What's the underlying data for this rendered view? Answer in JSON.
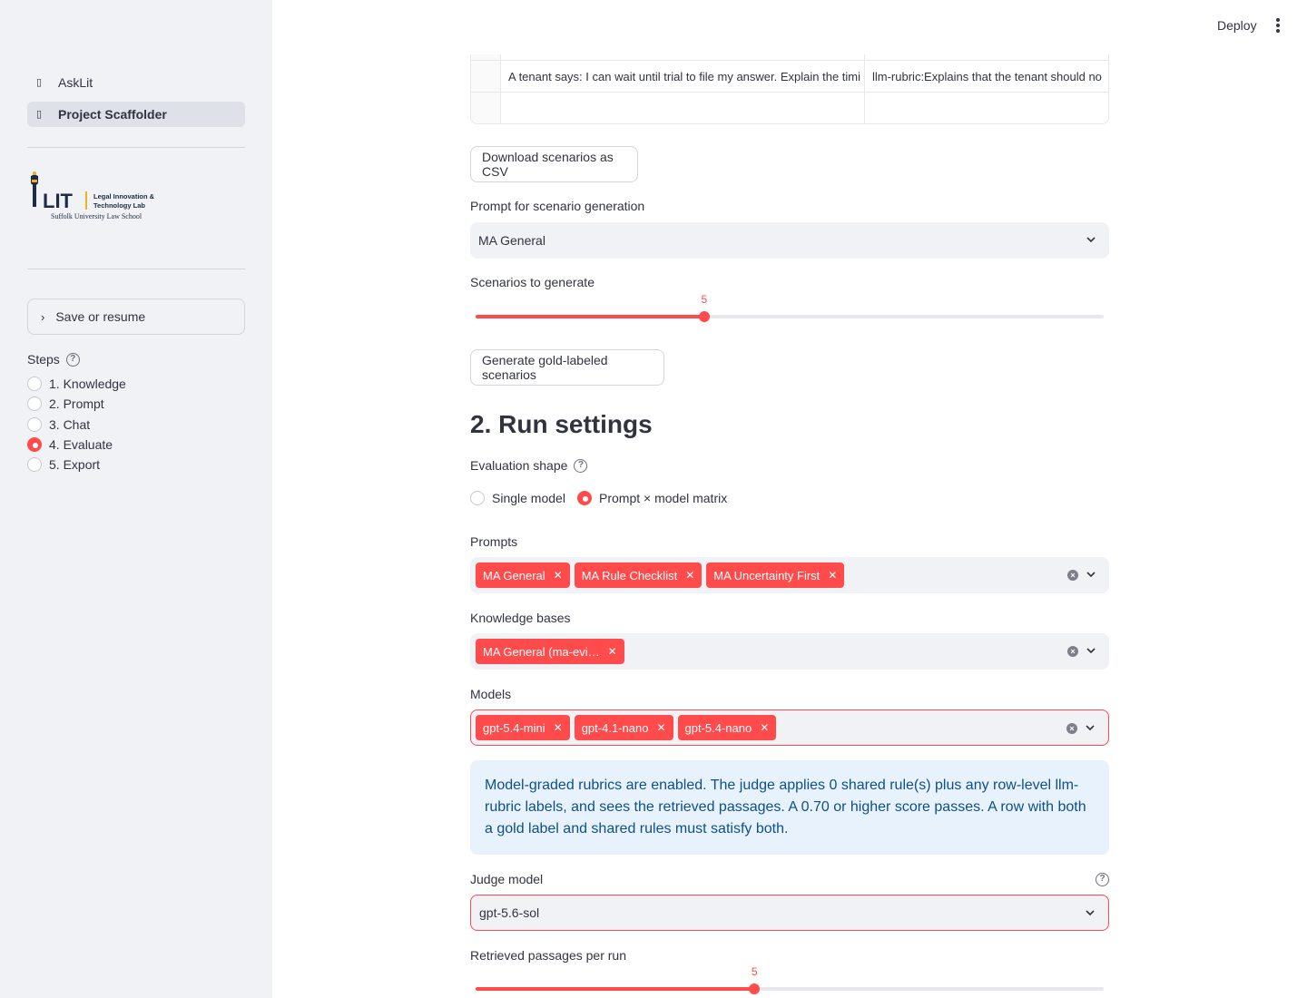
{
  "sidebar": {
    "nav": [
      {
        "label": "AskLit",
        "active": false
      },
      {
        "label": "Project Scaffolder",
        "active": true
      }
    ],
    "logo": {
      "mark": "LIT",
      "line1": "Legal Innovation &",
      "line2": "Technology Lab",
      "line3": "Suffolk University Law School"
    },
    "expander_label": "Save or resume",
    "steps_label": "Steps",
    "steps": [
      {
        "label": "1. Knowledge",
        "selected": false
      },
      {
        "label": "2. Prompt",
        "selected": false
      },
      {
        "label": "3. Chat",
        "selected": false
      },
      {
        "label": "4. Evaluate",
        "selected": true
      },
      {
        "label": "5. Export",
        "selected": false
      }
    ]
  },
  "header": {
    "deploy_label": "Deploy"
  },
  "table": {
    "rows": [
      {
        "question": "A tenant says: I can wait until trial to file my answer. Explain the timi",
        "expected": "llm-rubric:Explains that the tenant should no"
      },
      {
        "question": "",
        "expected": ""
      }
    ]
  },
  "download_button": "Download scenarios as CSV",
  "scenario_prompt": {
    "label": "Prompt for scenario generation",
    "value": "MA General"
  },
  "scenarios_slider": {
    "label": "Scenarios to generate",
    "value": "5",
    "fraction": 0.364
  },
  "generate_button": "Generate gold-labeled scenarios",
  "run_settings": {
    "heading": "2. Run settings",
    "shape_label": "Evaluation shape",
    "shape_options": [
      {
        "label": "Single model",
        "selected": false
      },
      {
        "label": "Prompt × model matrix",
        "selected": true
      }
    ],
    "prompts_label": "Prompts",
    "prompts": [
      "MA General",
      "MA Rule Checklist",
      "MA Uncertainty First"
    ],
    "kb_label": "Knowledge bases",
    "knowledge_bases": [
      "MA General (ma-evi…"
    ],
    "models_label": "Models",
    "models": [
      "gpt-5.4-mini",
      "gpt-4.1-nano",
      "gpt-5.4-nano"
    ],
    "info_text": "Model-graded rubrics are enabled. The judge applies 0 shared rule(s) plus any row-level llm-rubric labels, and sees the retrieved passages. A 0.70 or higher score passes. A row with both a gold label and shared rules must satisfy both.",
    "judge_label": "Judge model",
    "judge_value": "gpt-5.6-sol",
    "passages_label": "Retrieved passages per run",
    "passages_value": "5",
    "passages_fraction": 0.444
  },
  "colors": {
    "accent": "#ff4b4b",
    "sidebar_bg": "#f0f2f6",
    "info_bg": "#e8f2fd",
    "info_text": "#0d4f8b"
  }
}
